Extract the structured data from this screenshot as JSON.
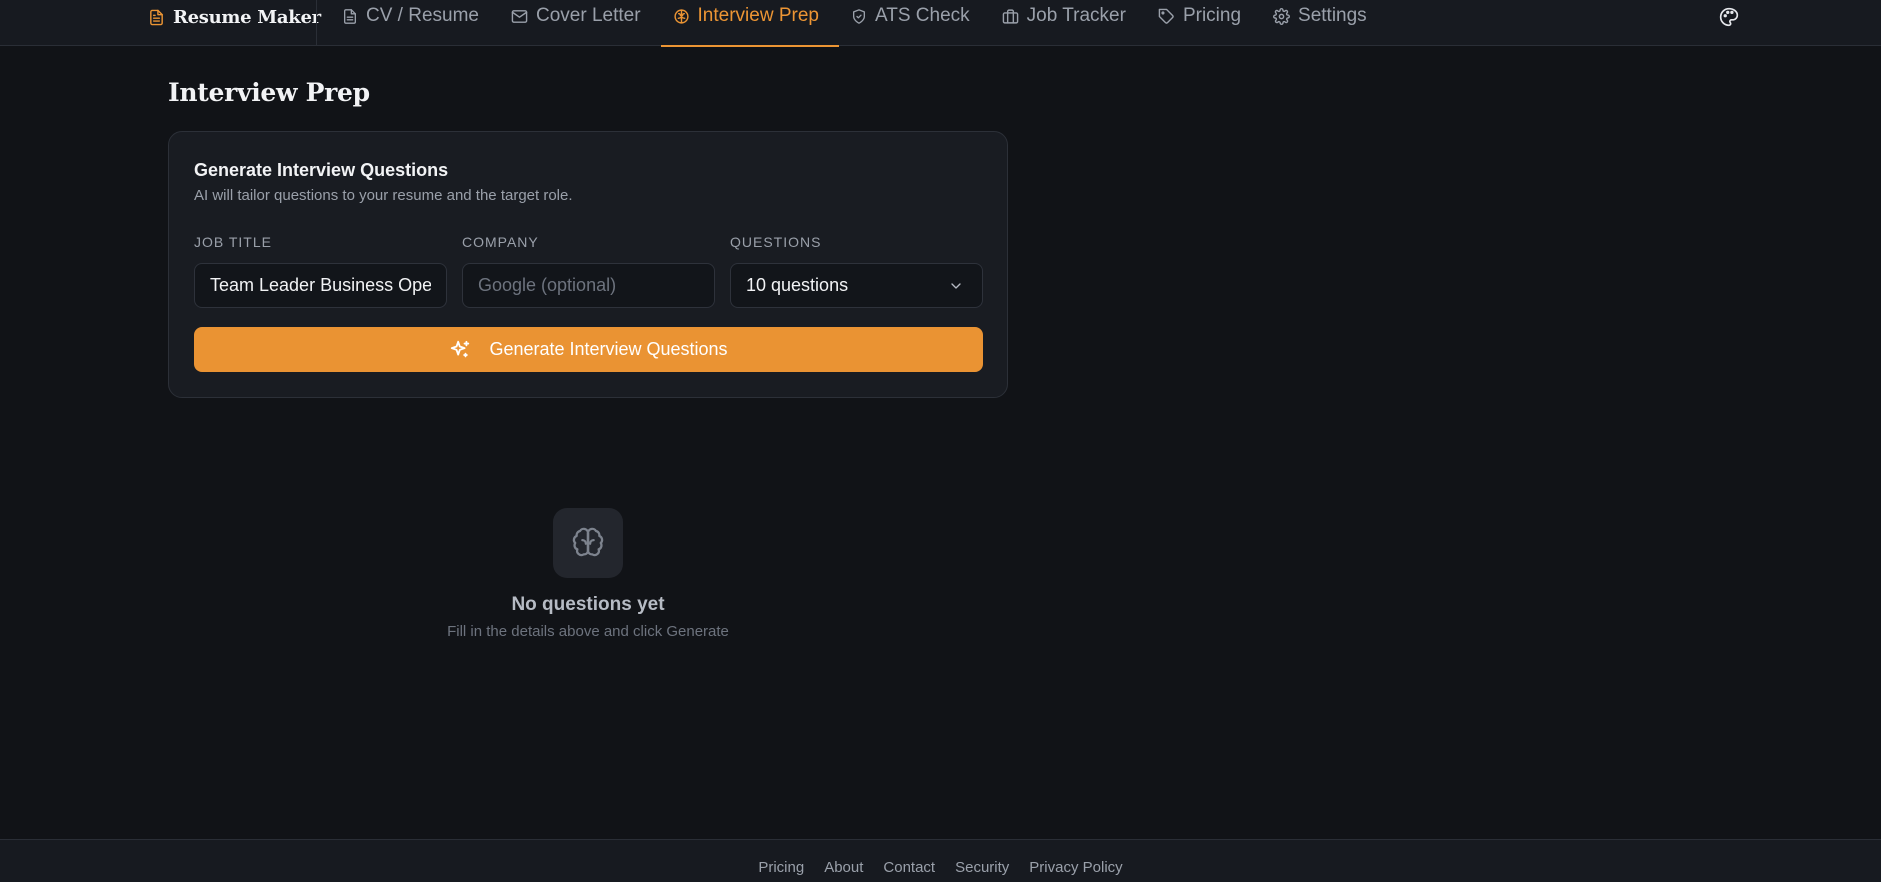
{
  "brand": {
    "name": "Resume Maker",
    "icon": "file-text-icon"
  },
  "nav": [
    {
      "label": "CV / Resume",
      "icon": "file-icon"
    },
    {
      "label": "Cover Letter",
      "icon": "mail-icon"
    },
    {
      "label": "Interview Prep",
      "icon": "brain-icon",
      "active": true
    },
    {
      "label": "ATS Check",
      "icon": "shield-check-icon"
    },
    {
      "label": "Job Tracker",
      "icon": "briefcase-icon"
    },
    {
      "label": "Pricing",
      "icon": "tag-icon"
    },
    {
      "label": "Settings",
      "icon": "gear-icon"
    }
  ],
  "header": {
    "theme_icon": "palette-icon"
  },
  "page": {
    "title": "Interview Prep"
  },
  "card": {
    "title": "Generate Interview Questions",
    "subtitle": "AI will tailor questions to your resume and the target role.",
    "job_title": {
      "label": "JOB TITLE",
      "value": "Team Leader Business Operations"
    },
    "company": {
      "label": "COMPANY",
      "placeholder": "Google (optional)",
      "value": ""
    },
    "questions": {
      "label": "QUESTIONS",
      "selected": "10 questions"
    },
    "generate_label": "Generate Interview Questions"
  },
  "empty": {
    "title": "No questions yet",
    "subtitle": "Fill in the details above and click Generate"
  },
  "footer": {
    "links": [
      "Pricing",
      "About",
      "Contact",
      "Security",
      "Privacy Policy"
    ]
  },
  "colors": {
    "accent": "#ea9333",
    "background": "#111317",
    "surface": "#191c22",
    "muted_text": "#9aa0aa"
  }
}
